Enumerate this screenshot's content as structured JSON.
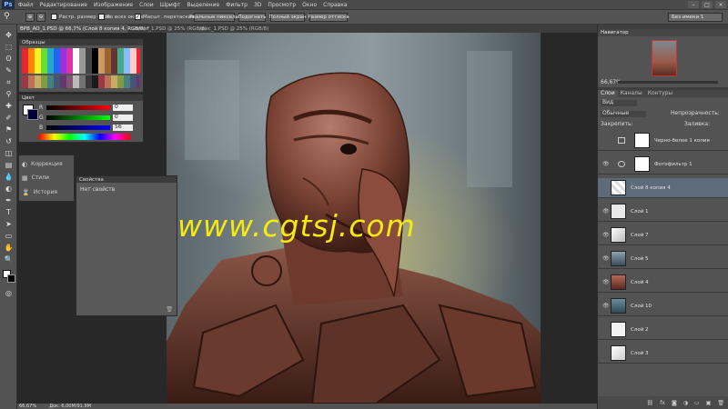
{
  "app": {
    "logo": "Ps"
  },
  "menu": [
    "Файл",
    "Редактирование",
    "Изображение",
    "Слои",
    "Шрифт",
    "Выделение",
    "Фильтр",
    "3D",
    "Просмотр",
    "Окно",
    "Справка"
  ],
  "window_buttons": [
    "–",
    "□",
    "×"
  ],
  "options": {
    "fit_window": "Растр. размер окон",
    "all_windows": "Во всех окнах",
    "scrubby_zoom": "Масшт. перетаскиванием",
    "actual_pixels": "Реальные пикселы",
    "fit_screen": "Подогнать",
    "fill_screen": "Полный экран",
    "print_size": "Размер оттиска",
    "workspace": "Без имени 1"
  },
  "tabs": [
    "BPB_AO_1.PSD @ 66,7% (Слой 8 копия 4, RGB/8) *",
    "normal_1.PSD @ 25% (RGB/8)",
    "spec_1.PSD @ 25% (RGB/8)"
  ],
  "watermark": "www.cgtsj.com",
  "status": {
    "zoom": "66,67%",
    "doc": "Док: 6,00М/91,9М"
  },
  "swatches_panel": {
    "title": "Образцы"
  },
  "color_panel": {
    "title": "Цвет",
    "channels": [
      {
        "label": "R",
        "value": "0"
      },
      {
        "label": "G",
        "value": "0"
      },
      {
        "label": "B",
        "value": "56"
      }
    ]
  },
  "adjust_panel": {
    "items": [
      "Коррекция",
      "Стили",
      "История"
    ]
  },
  "properties_panel": {
    "title": "Свойства",
    "empty": "Нет свойств"
  },
  "navigator": {
    "title": "Навигатор",
    "zoom": "66,67%"
  },
  "layers_panel": {
    "tabs": [
      "Слои",
      "Каналы",
      "Контуры"
    ],
    "kind": "Вид",
    "blend_mode": "Обычные",
    "opacity_label": "Непрозрачность:",
    "lock_label": "Закрепить:",
    "fill_label": "Заливка:",
    "layers": [
      {
        "name": "Черно-белое 1 копия"
      },
      {
        "name": "Фотофильтр 1"
      },
      {
        "name": "Слой 8 копия 4"
      },
      {
        "name": "Слой 1"
      },
      {
        "name": "Слой 7"
      },
      {
        "name": "Слой 5"
      },
      {
        "name": "Слой 4"
      },
      {
        "name": "Слой 10"
      },
      {
        "name": "Слой 2"
      },
      {
        "name": "Слой 3"
      }
    ]
  },
  "colors": {
    "accent_selected": "#5d6b7b",
    "watermark": "#f5ea10",
    "panel_bg": "#535353"
  }
}
